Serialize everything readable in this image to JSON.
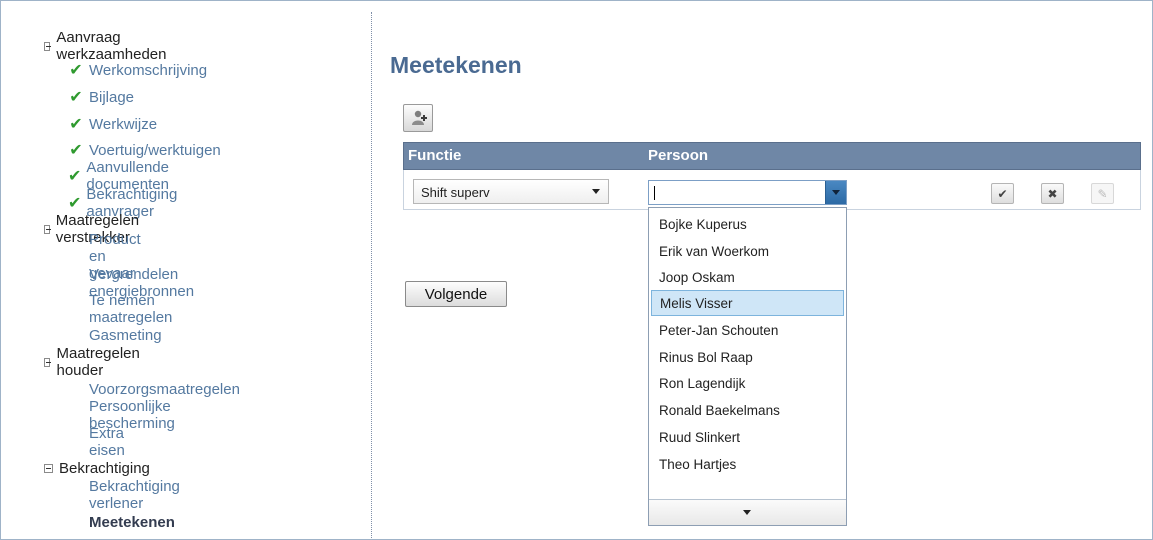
{
  "sidebar": {
    "sections": [
      {
        "label": "Aanvraag werkzaamheden",
        "items": [
          {
            "label": "Werkomschrijving",
            "done": true
          },
          {
            "label": "Bijlage",
            "done": true
          },
          {
            "label": "Werkwijze",
            "done": true
          },
          {
            "label": "Voertuig/werktuigen",
            "done": true
          },
          {
            "label": "Aanvullende documenten",
            "done": true
          },
          {
            "label": "Bekrachtiging aanvrager",
            "done": true
          }
        ]
      },
      {
        "label": "Maatregelen verstrekker",
        "items": [
          {
            "label": "Product en gevaar"
          },
          {
            "label": "Vergrendelen energiebronnen"
          },
          {
            "label": "Te nemen maatregelen"
          },
          {
            "label": "Gasmeting"
          }
        ]
      },
      {
        "label": "Maatregelen houder",
        "items": [
          {
            "label": "Voorzorgsmaatregelen"
          },
          {
            "label": "Persoonlijke bescherming"
          },
          {
            "label": "Extra eisen"
          }
        ]
      },
      {
        "label": "Bekrachtiging",
        "items": [
          {
            "label": "Bekrachtiging verlener"
          },
          {
            "label": "Meetekenen",
            "current": true
          }
        ]
      }
    ]
  },
  "main": {
    "title": "Meetekenen",
    "grid": {
      "columns": [
        "Functie",
        "Persoon"
      ],
      "row": {
        "functie": "Shift superv",
        "persoon": ""
      }
    },
    "dropdown": {
      "options": [
        "Bojke Kuperus",
        "Erik van Woerkom",
        "Joop Oskam",
        "Melis Visser",
        "Peter-Jan Schouten",
        "Rinus Bol Raap",
        "Ron Lagendijk",
        "Ronald Baekelmans",
        "Ruud Slinkert",
        "Theo Hartjes"
      ],
      "highlighted": "Melis Visser"
    },
    "next_label": "Volgende"
  },
  "icons": {
    "done": "check-icon",
    "section_toggle": "collapse-icon",
    "add": "add-person-icon",
    "confirm": "confirm-icon",
    "delete": "delete-icon",
    "edit": "edit-icon"
  },
  "colors": {
    "header_bg": "#6f87a6",
    "title": "#4a6a92",
    "link": "#5479a0",
    "check": "#2f9a2f",
    "selection": "#cfe6f7"
  }
}
